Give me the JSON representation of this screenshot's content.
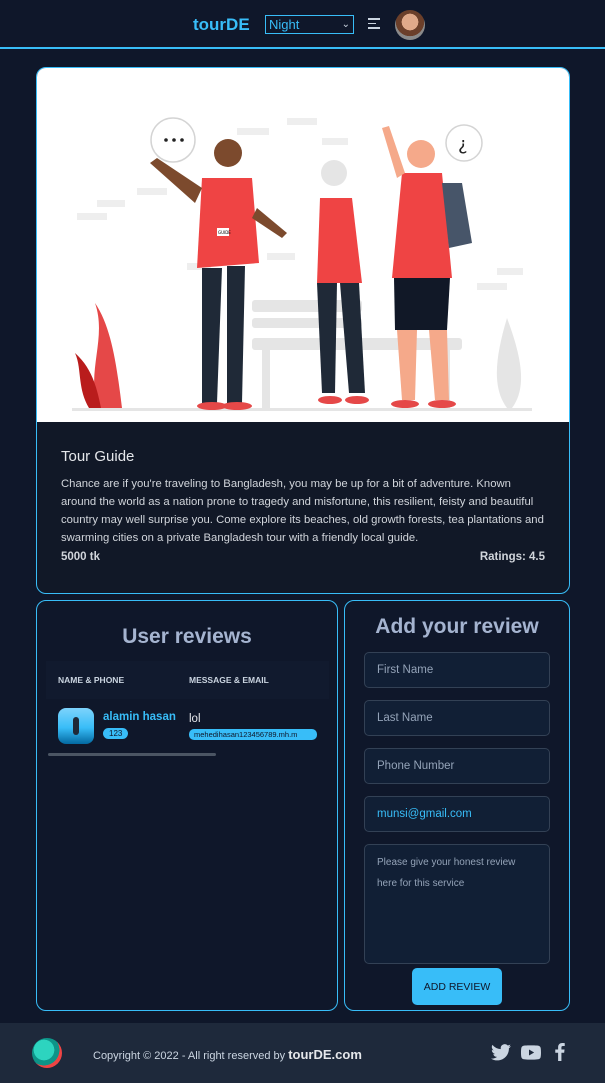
{
  "navbar": {
    "brand": "tourDE",
    "theme_selected": "Night"
  },
  "tour": {
    "title": "Tour Guide",
    "description": "Chance are if you're traveling to Bangladesh, you may be up for a bit of adventure. Known around the world as a nation prone to tragedy and misfortune, this resilient, feisty and beautiful country may well surprise you. Come explore its beaches, old growth forests, tea plantations and swarming cities on a private Bangladesh tour with a friendly local guide.",
    "price": "5000 tk",
    "ratings": "Ratings: 4.5",
    "image_badge": "GUIDE"
  },
  "reviews": {
    "title": "User reviews",
    "columns": [
      "NAME & PHONE",
      "MESSAGE & EMAIL"
    ],
    "rows": [
      {
        "name": "alamin hasan",
        "phone": "123",
        "message": "lol",
        "email": "mehedihasan123456789.mh.m"
      }
    ]
  },
  "add_review": {
    "title": "Add your review",
    "first_name_placeholder": "First Name",
    "last_name_placeholder": "Last Name",
    "phone_placeholder": "Phone Number",
    "email_value": "munsi@gmail.com",
    "review_placeholder": "Please give your honest review here for this service",
    "submit_label": "ADD REVIEW"
  },
  "footer": {
    "copyright": "Copyright © 2022 - All right reserved by",
    "brand": "tourDE.com"
  },
  "colors": {
    "accent": "#38bdf8",
    "background": "#0f172a",
    "footer": "#1e293b"
  }
}
